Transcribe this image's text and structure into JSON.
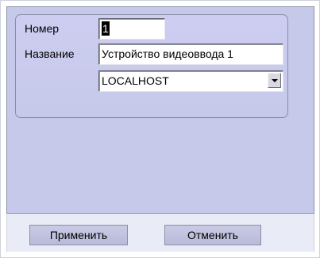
{
  "form": {
    "number_label": "Номер",
    "number_value": "1",
    "name_label": "Название",
    "name_value": "Устройство видеоввода 1",
    "host_value": "LOCALHOST"
  },
  "buttons": {
    "apply": "Применить",
    "cancel": "Отменить"
  },
  "icons": {
    "dropdown": "chevron-down-icon"
  },
  "colors": {
    "panel_bg": "#c7c9ea",
    "footer_bg": "#e9ebf6"
  }
}
